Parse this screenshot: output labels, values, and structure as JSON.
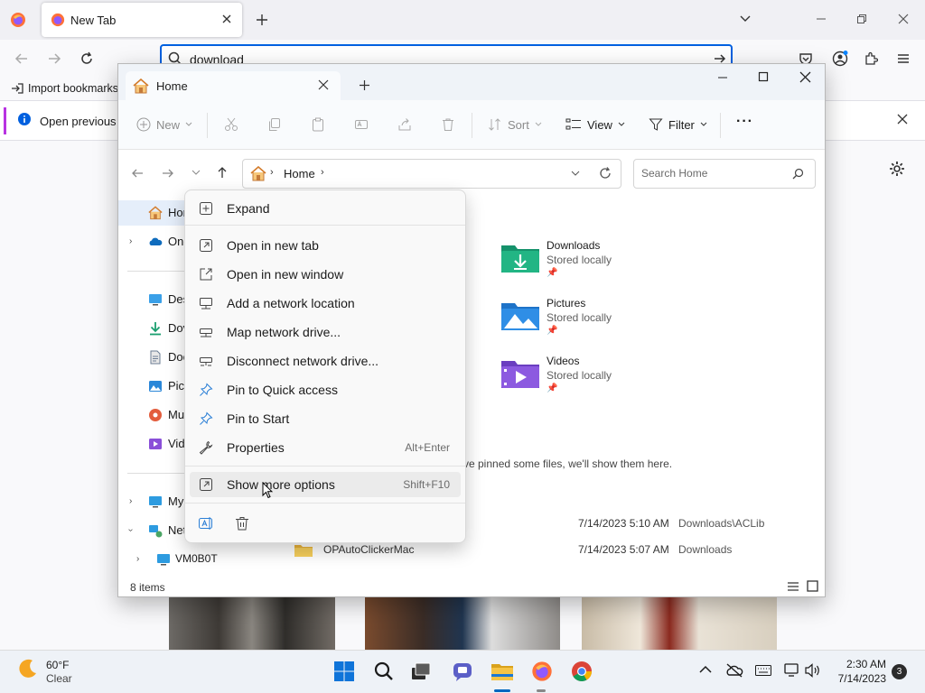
{
  "firefox": {
    "tab_title": "New Tab",
    "url_value": "download",
    "bookmark": "Import bookmarks",
    "notification": "Open previous ta"
  },
  "explorer": {
    "tab_title": "Home",
    "toolbar": {
      "new": "New",
      "sort": "Sort",
      "view": "View",
      "filter": "Filter",
      "more": "···"
    },
    "breadcrumb": "Home",
    "search_placeholder": "Search Home",
    "nav": {
      "home": "Hon",
      "onedrive": "One",
      "desktop": "Des",
      "downloads": "Dov",
      "documents": "Doc",
      "pictures": "Pict",
      "music": "Mu",
      "videos": "Vid",
      "mypc": "My",
      "network": "Net",
      "vm": "VM0B0T"
    },
    "quick_access": [
      {
        "name": "Downloads",
        "sub": "Stored locally"
      },
      {
        "name": "Pictures",
        "sub": "Stored locally"
      },
      {
        "name": "Videos",
        "sub": "Stored locally"
      }
    ],
    "favorites_hint": "ve pinned some files, we'll show them here.",
    "files": [
      {
        "name": "",
        "date": "7/14/2023 5:10 AM",
        "location": "Downloads\\ACLib"
      },
      {
        "name": "OPAutoClickerMac",
        "date": "7/14/2023 5:07 AM",
        "location": "Downloads"
      }
    ],
    "status": "8 items"
  },
  "context_menu": {
    "items": [
      {
        "label": "Expand"
      },
      {
        "label": "Open in new tab"
      },
      {
        "label": "Open in new window"
      },
      {
        "label": "Add a network location"
      },
      {
        "label": "Map network drive..."
      },
      {
        "label": "Disconnect network drive..."
      },
      {
        "label": "Pin to Quick access"
      },
      {
        "label": "Pin to Start"
      },
      {
        "label": "Properties",
        "shortcut": "Alt+Enter"
      },
      {
        "label": "Show more options",
        "shortcut": "Shift+F10"
      }
    ]
  },
  "taskbar": {
    "weather_temp": "60°F",
    "weather_desc": "Clear",
    "time": "2:30 AM",
    "date": "7/14/2023",
    "notif_count": "3"
  },
  "colors": {
    "accent": "#0067c0",
    "folder": "#f0c23b",
    "downloads_folder": "#1aa57a"
  }
}
